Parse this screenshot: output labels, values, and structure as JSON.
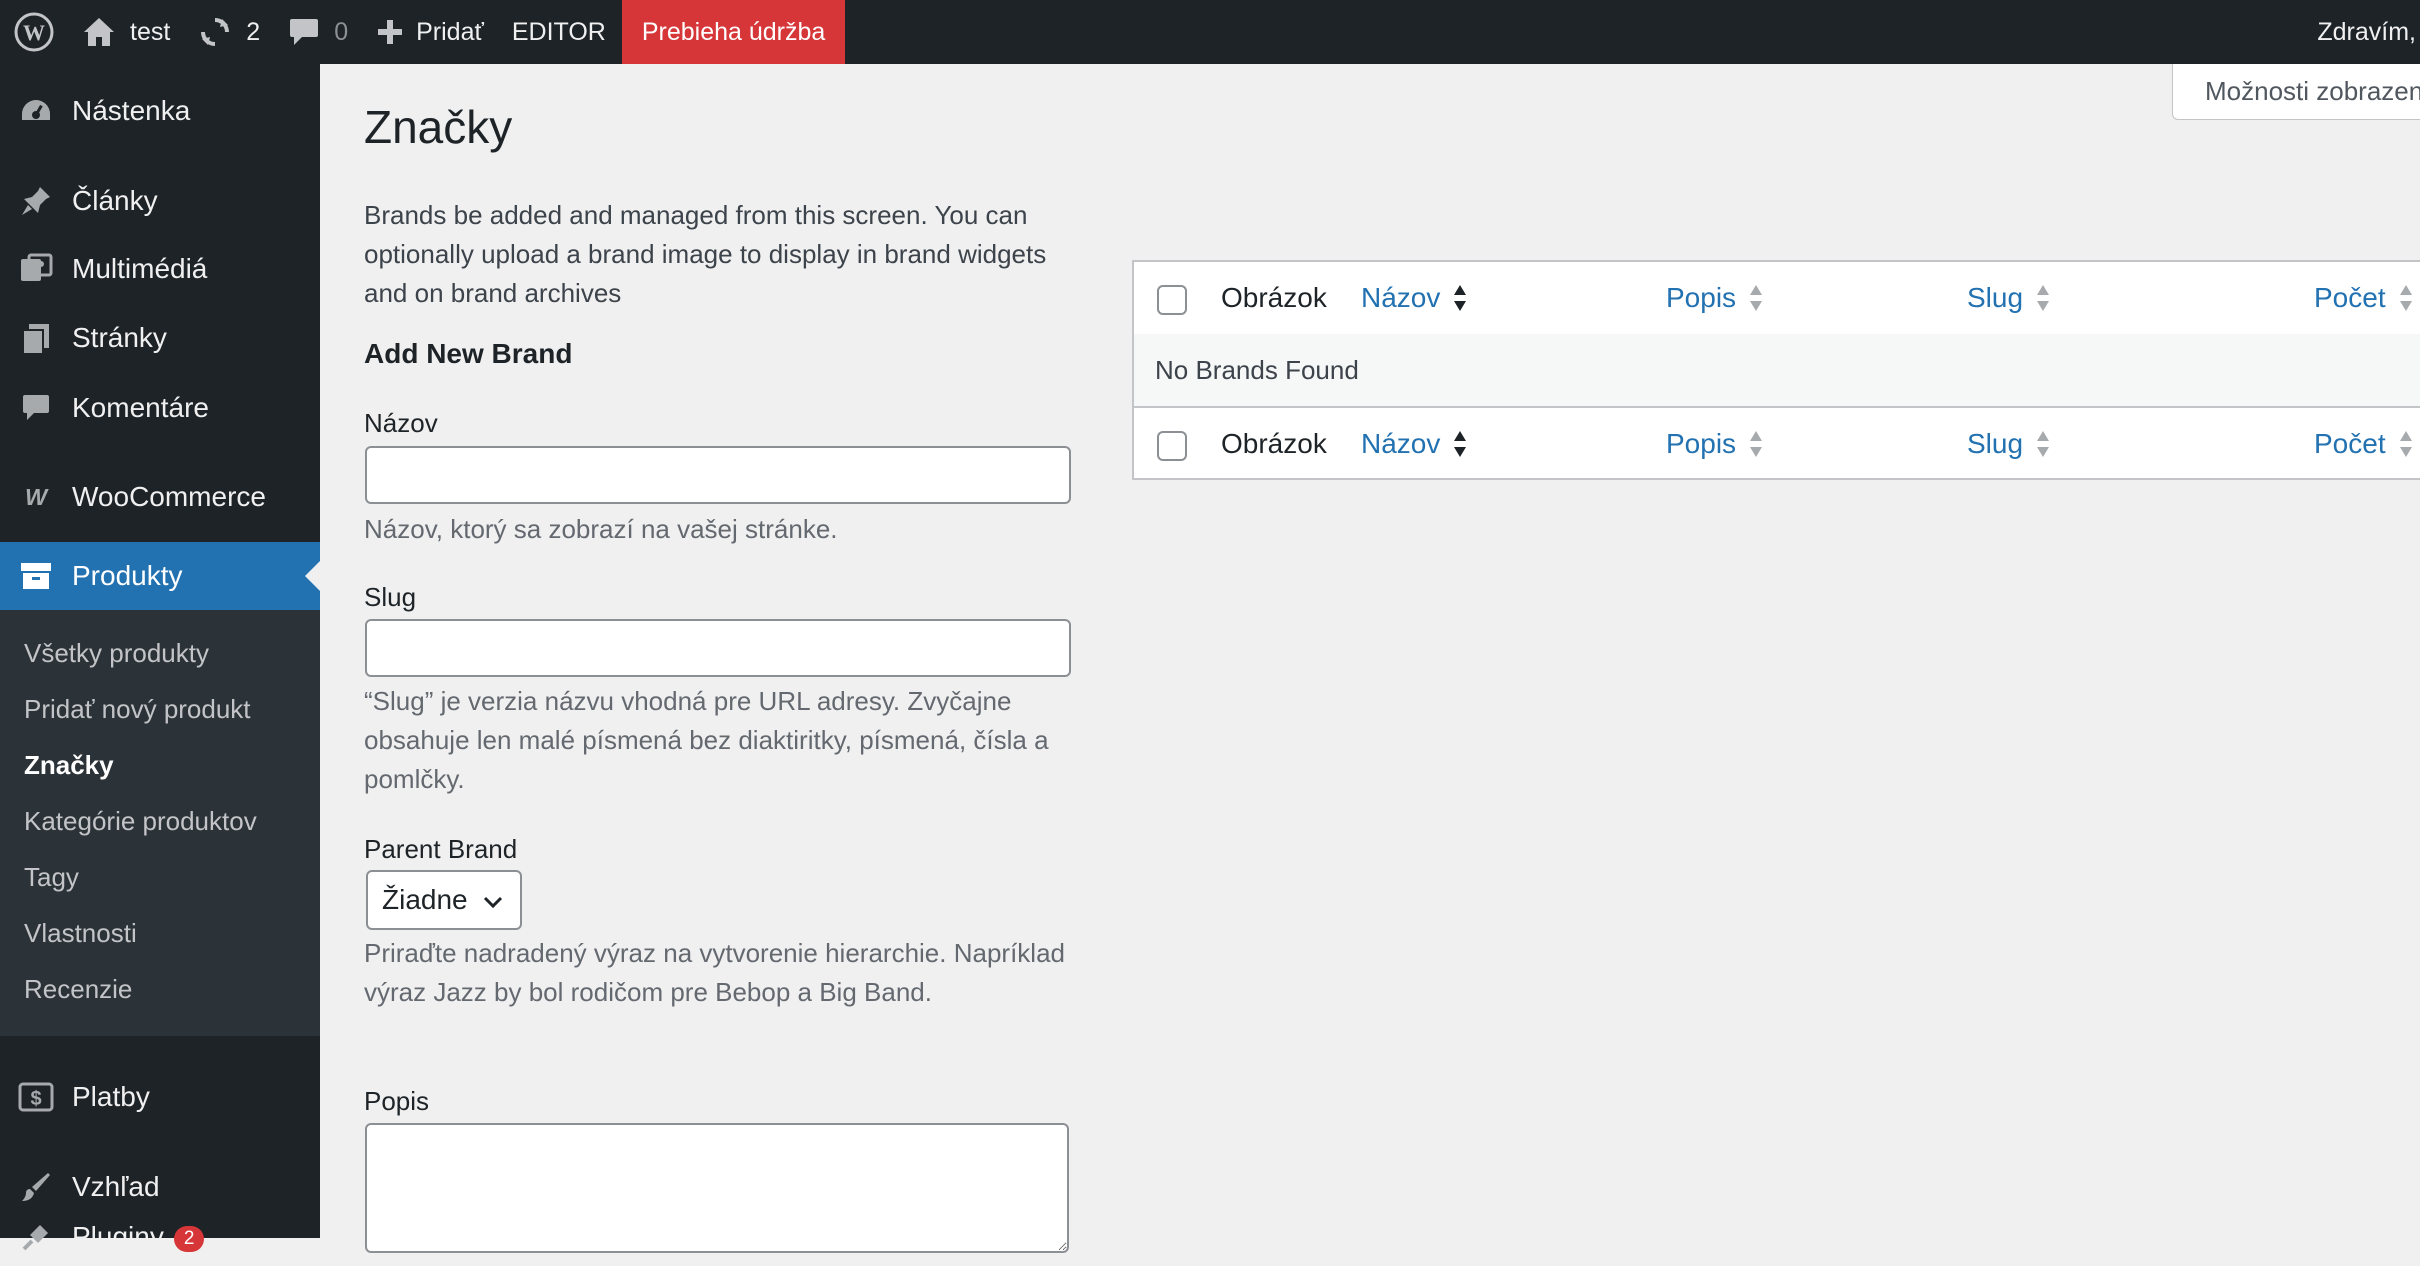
{
  "adminbar": {
    "site_name": "test",
    "updates_count": "2",
    "comments_count": "0",
    "add_new": "Pridať",
    "editor": "EDITOR",
    "maintenance": "Prebieha údržba",
    "greeting": "Zdravím,",
    "icons": [
      "wordpress-icon",
      "home-icon",
      "refresh-icon",
      "comment-icon",
      "plus-icon"
    ]
  },
  "sidebar": {
    "items": [
      {
        "label": "Nástenka",
        "icon": "dashboard-icon"
      },
      {
        "label": "Články",
        "icon": "pin-icon"
      },
      {
        "label": "Multimédiá",
        "icon": "media-icon"
      },
      {
        "label": "Stránky",
        "icon": "pages-icon"
      },
      {
        "label": "Komentáre",
        "icon": "comment-icon"
      },
      {
        "label": "WooCommerce",
        "icon": "woocommerce-icon"
      },
      {
        "label": "Produkty",
        "icon": "archive-icon"
      },
      {
        "label": "Platby",
        "icon": "payments-icon"
      },
      {
        "label": "Vzhľad",
        "icon": "brush-icon"
      },
      {
        "label": "Pluginy",
        "icon": "plugin-icon",
        "badge": "2"
      }
    ],
    "submenu": [
      "Všetky produkty",
      "Pridať nový produkt",
      "Značky",
      "Kategórie produktov",
      "Tagy",
      "Vlastnosti",
      "Recenzie"
    ],
    "current_submenu": "Značky",
    "accent_color": "#2271b1",
    "bg_color": "#1d2327"
  },
  "screen_options": "Možnosti zobrazenia",
  "page": {
    "title": "Značky",
    "description": "Brands be added and managed from this screen. You can optionally upload a brand image to display in brand widgets and on brand archives"
  },
  "form": {
    "heading": "Add New Brand",
    "name_label": "Názov",
    "name_help": "Názov, ktorý sa zobrazí na vašej stránke.",
    "slug_label": "Slug",
    "slug_help": "“Slug” je verzia názvu vhodná pre URL adresy. Zvyčajne obsahuje len malé písmená bez diaktiritky, písmená, čísla a pomlčky.",
    "parent_label": "Parent Brand",
    "parent_value": "Žiadne",
    "parent_help": "Priraďte nadradený výraz na vytvorenie hierarchie. Napríklad výraz Jazz by bol rodičom pre Bebop a Big Band.",
    "description_label": "Popis"
  },
  "table": {
    "columns": [
      "Obrázok",
      "Názov",
      "Popis",
      "Slug",
      "Počet"
    ],
    "empty_message": "No Brands Found",
    "link_color": "#2271b1"
  }
}
